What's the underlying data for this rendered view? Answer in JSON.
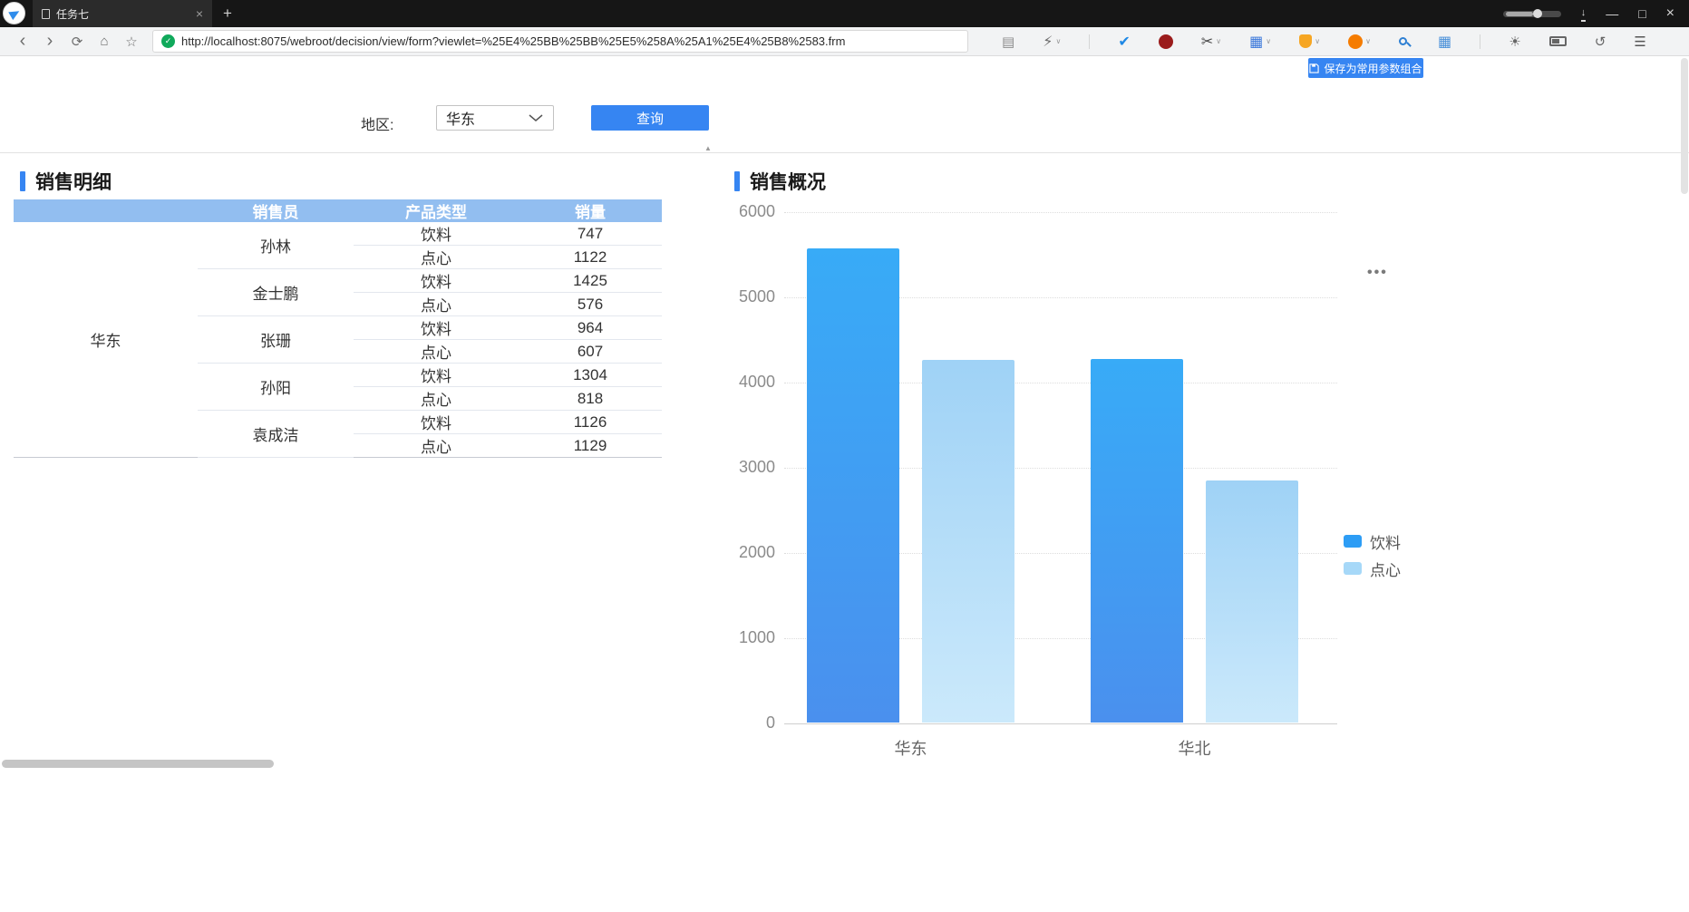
{
  "browser": {
    "tab_title": "任务七",
    "url": "http://localhost:8075/webroot/decision/view/form?viewlet=%25E4%25BB%25BB%25E5%258A%25A1%25E4%25B8%2583.frm"
  },
  "icons": {
    "tab_close": "×",
    "new_tab": "+",
    "minimize": "—",
    "maximize": "□",
    "window_close": "×",
    "download": "↓",
    "back": "‹",
    "forward": "›",
    "refresh": "⟳",
    "home": "⌂",
    "star": "☆",
    "shield_check": "✓",
    "reader": "▤",
    "lightning": "⚡",
    "chevron_down": "∨",
    "ext_check": "✔",
    "scissors": "✂",
    "ext_table": "▦",
    "ext_grid": "▦",
    "sun": "☀",
    "undo": "↺",
    "menu": "☰",
    "collapse": "▲",
    "more": "•••"
  },
  "toolbar": {
    "save_param_label": "保存为常用参数组合"
  },
  "param_form": {
    "region_label": "地区:",
    "region_value": "华东",
    "query_label": "查询"
  },
  "sales_detail": {
    "title": "销售明细",
    "columns": {
      "seller": "销售员",
      "product_type": "产品类型",
      "volume": "销量"
    },
    "region": "华东",
    "rows": [
      {
        "seller": "孙林",
        "items": [
          {
            "type": "饮料",
            "value": 747
          },
          {
            "type": "点心",
            "value": 1122
          }
        ]
      },
      {
        "seller": "金士鹏",
        "items": [
          {
            "type": "饮料",
            "value": 1425
          },
          {
            "type": "点心",
            "value": 576
          }
        ]
      },
      {
        "seller": "张珊",
        "items": [
          {
            "type": "饮料",
            "value": 964
          },
          {
            "type": "点心",
            "value": 607
          }
        ]
      },
      {
        "seller": "孙阳",
        "items": [
          {
            "type": "饮料",
            "value": 1304
          },
          {
            "type": "点心",
            "value": 818
          }
        ]
      },
      {
        "seller": "袁成洁",
        "items": [
          {
            "type": "饮料",
            "value": 1126
          },
          {
            "type": "点心",
            "value": 1129
          }
        ]
      }
    ]
  },
  "sales_overview": {
    "title": "销售概况"
  },
  "chart_data": {
    "type": "bar",
    "title": "销售概况",
    "categories": [
      "华东",
      "华北"
    ],
    "series": [
      {
        "name": "饮料",
        "values": [
          5566,
          4270
        ],
        "color": "#2D9DF5",
        "gradient": [
          "#38ABF7",
          "#4A90EE"
        ]
      },
      {
        "name": "点心",
        "values": [
          4252,
          2840
        ],
        "color": "#A6D8F8",
        "gradient": [
          "#9FD2F6",
          "#CBE9FB"
        ]
      }
    ],
    "xlabel": "",
    "ylabel": "",
    "ylim": [
      0,
      6000
    ],
    "yticks": [
      0,
      1000,
      2000,
      3000,
      4000,
      5000,
      6000
    ],
    "grid": "dotted-horizontal",
    "legend_position": "right"
  }
}
